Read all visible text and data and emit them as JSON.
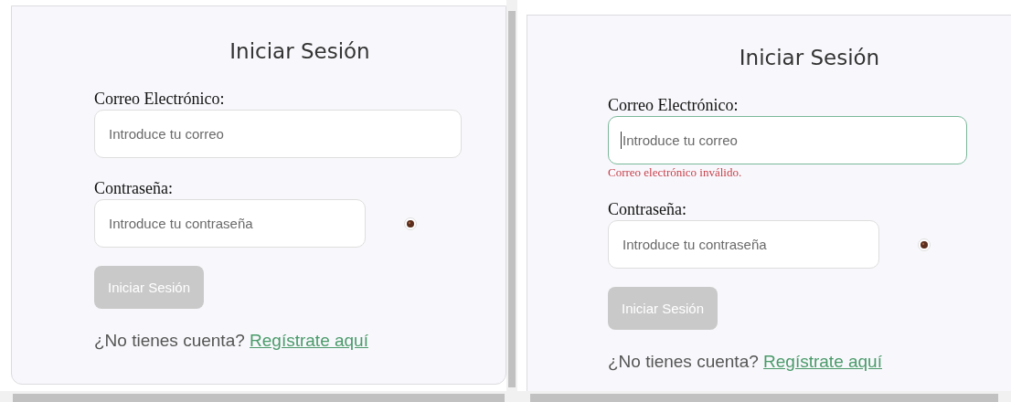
{
  "panes": [
    {
      "title": "Iniciar Sesión",
      "fields": [
        {
          "kind": "email",
          "label": "Correo Electrónico:",
          "placeholder": "Introduce tu correo",
          "focused": false
        },
        {
          "kind": "password",
          "label": "Contraseña:",
          "placeholder": "Introduce tu contraseña",
          "focused": false
        }
      ],
      "submit": {
        "label": "Iniciar Sesión",
        "disabled": true
      },
      "footer": {
        "text": "¿No tienes cuenta?",
        "link": "Regístrate aquí"
      }
    },
    {
      "title": "Iniciar Sesión",
      "fields": [
        {
          "kind": "email",
          "label": "Correo Electrónico:",
          "placeholder": "Introduce tu correo",
          "focused": true,
          "error": "Correo electrónico inválido."
        },
        {
          "kind": "password",
          "label": "Contraseña:",
          "placeholder": "Introduce tu contraseña",
          "focused": false
        }
      ],
      "submit": {
        "label": "Iniciar Sesión",
        "disabled": true
      },
      "footer": {
        "text": "¿No tienes cuenta?",
        "link": "Regístrate aquí"
      }
    }
  ]
}
